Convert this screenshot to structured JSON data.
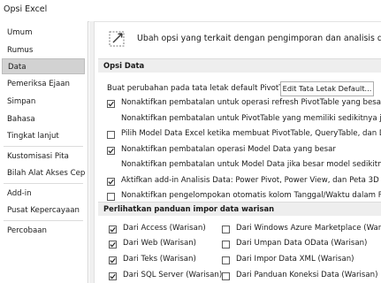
{
  "window": {
    "title": "Opsi Excel"
  },
  "sidebar": {
    "items": [
      {
        "label": "Umum"
      },
      {
        "label": "Rumus"
      },
      {
        "label": "Data"
      },
      {
        "label": "Pemeriksa Ejaan"
      },
      {
        "label": "Simpan"
      },
      {
        "label": "Bahasa"
      },
      {
        "label": "Tingkat lanjut"
      },
      {
        "label": "Kustomisasi Pita"
      },
      {
        "label": "Bilah Alat Akses Cepat"
      },
      {
        "label": "Add-in"
      },
      {
        "label": "Pusat Kepercayaan"
      },
      {
        "label": "Percobaan"
      }
    ],
    "selected": "Data"
  },
  "header": {
    "text": "Ubah opsi yang terkait dengan pengimporan dan analisis data."
  },
  "opsi_data": {
    "title": "Opsi Data",
    "layout_label": "Buat perubahan pada tata letak default PivotTable:",
    "layout_button": "Edit Tata Letak Default...",
    "options": [
      {
        "label": "Nonaktifkan pembatalan untuk operasi refresh PivotTable yang besar guna",
        "checked": true,
        "has_checkbox": true
      },
      {
        "label": "Nonaktifkan pembatalan untuk PivotTable yang memiliki sedikitnya jumlah",
        "checked": false,
        "has_checkbox": false
      },
      {
        "label": "Pilih Model Data Excel ketika membuat PivotTable, QueryTable, dan Data",
        "checked": false,
        "has_checkbox": true
      },
      {
        "label": "Nonaktifkan pembatalan operasi Model Data yang besar",
        "checked": true,
        "has_checkbox": true
      },
      {
        "label": "Nonaktifkan pembatalan untuk Model Data jika besar model sedikitnya (d",
        "checked": false,
        "has_checkbox": false
      },
      {
        "label": "Aktifkan add-in Analisis Data: Power Pivot, Power View, dan Peta 3D",
        "checked": true,
        "has_checkbox": true
      },
      {
        "label": "Nonaktifkan pengelompokan otomatis kolom Tanggal/Waktu dalam PivotTable",
        "checked": false,
        "has_checkbox": true
      }
    ]
  },
  "legacy": {
    "title": "Perlihatkan panduan impor data warisan",
    "left": [
      {
        "label": "Dari Access (Warisan)",
        "checked": true
      },
      {
        "label": "Dari Web (Warisan)",
        "checked": true
      },
      {
        "label": "Dari Teks (Warisan)",
        "checked": true
      },
      {
        "label": "Dari SQL Server (Warisan)",
        "checked": true
      }
    ],
    "right": [
      {
        "label": "Dari Windows Azure Marketplace (Warisan)",
        "checked": false
      },
      {
        "label": "Dari Umpan Data OData (Warisan)",
        "checked": false
      },
      {
        "label": "Dari Impor Data XML (Warisan)",
        "checked": false
      },
      {
        "label": "Dari Panduan Koneksi Data (Warisan)",
        "checked": false
      }
    ]
  }
}
